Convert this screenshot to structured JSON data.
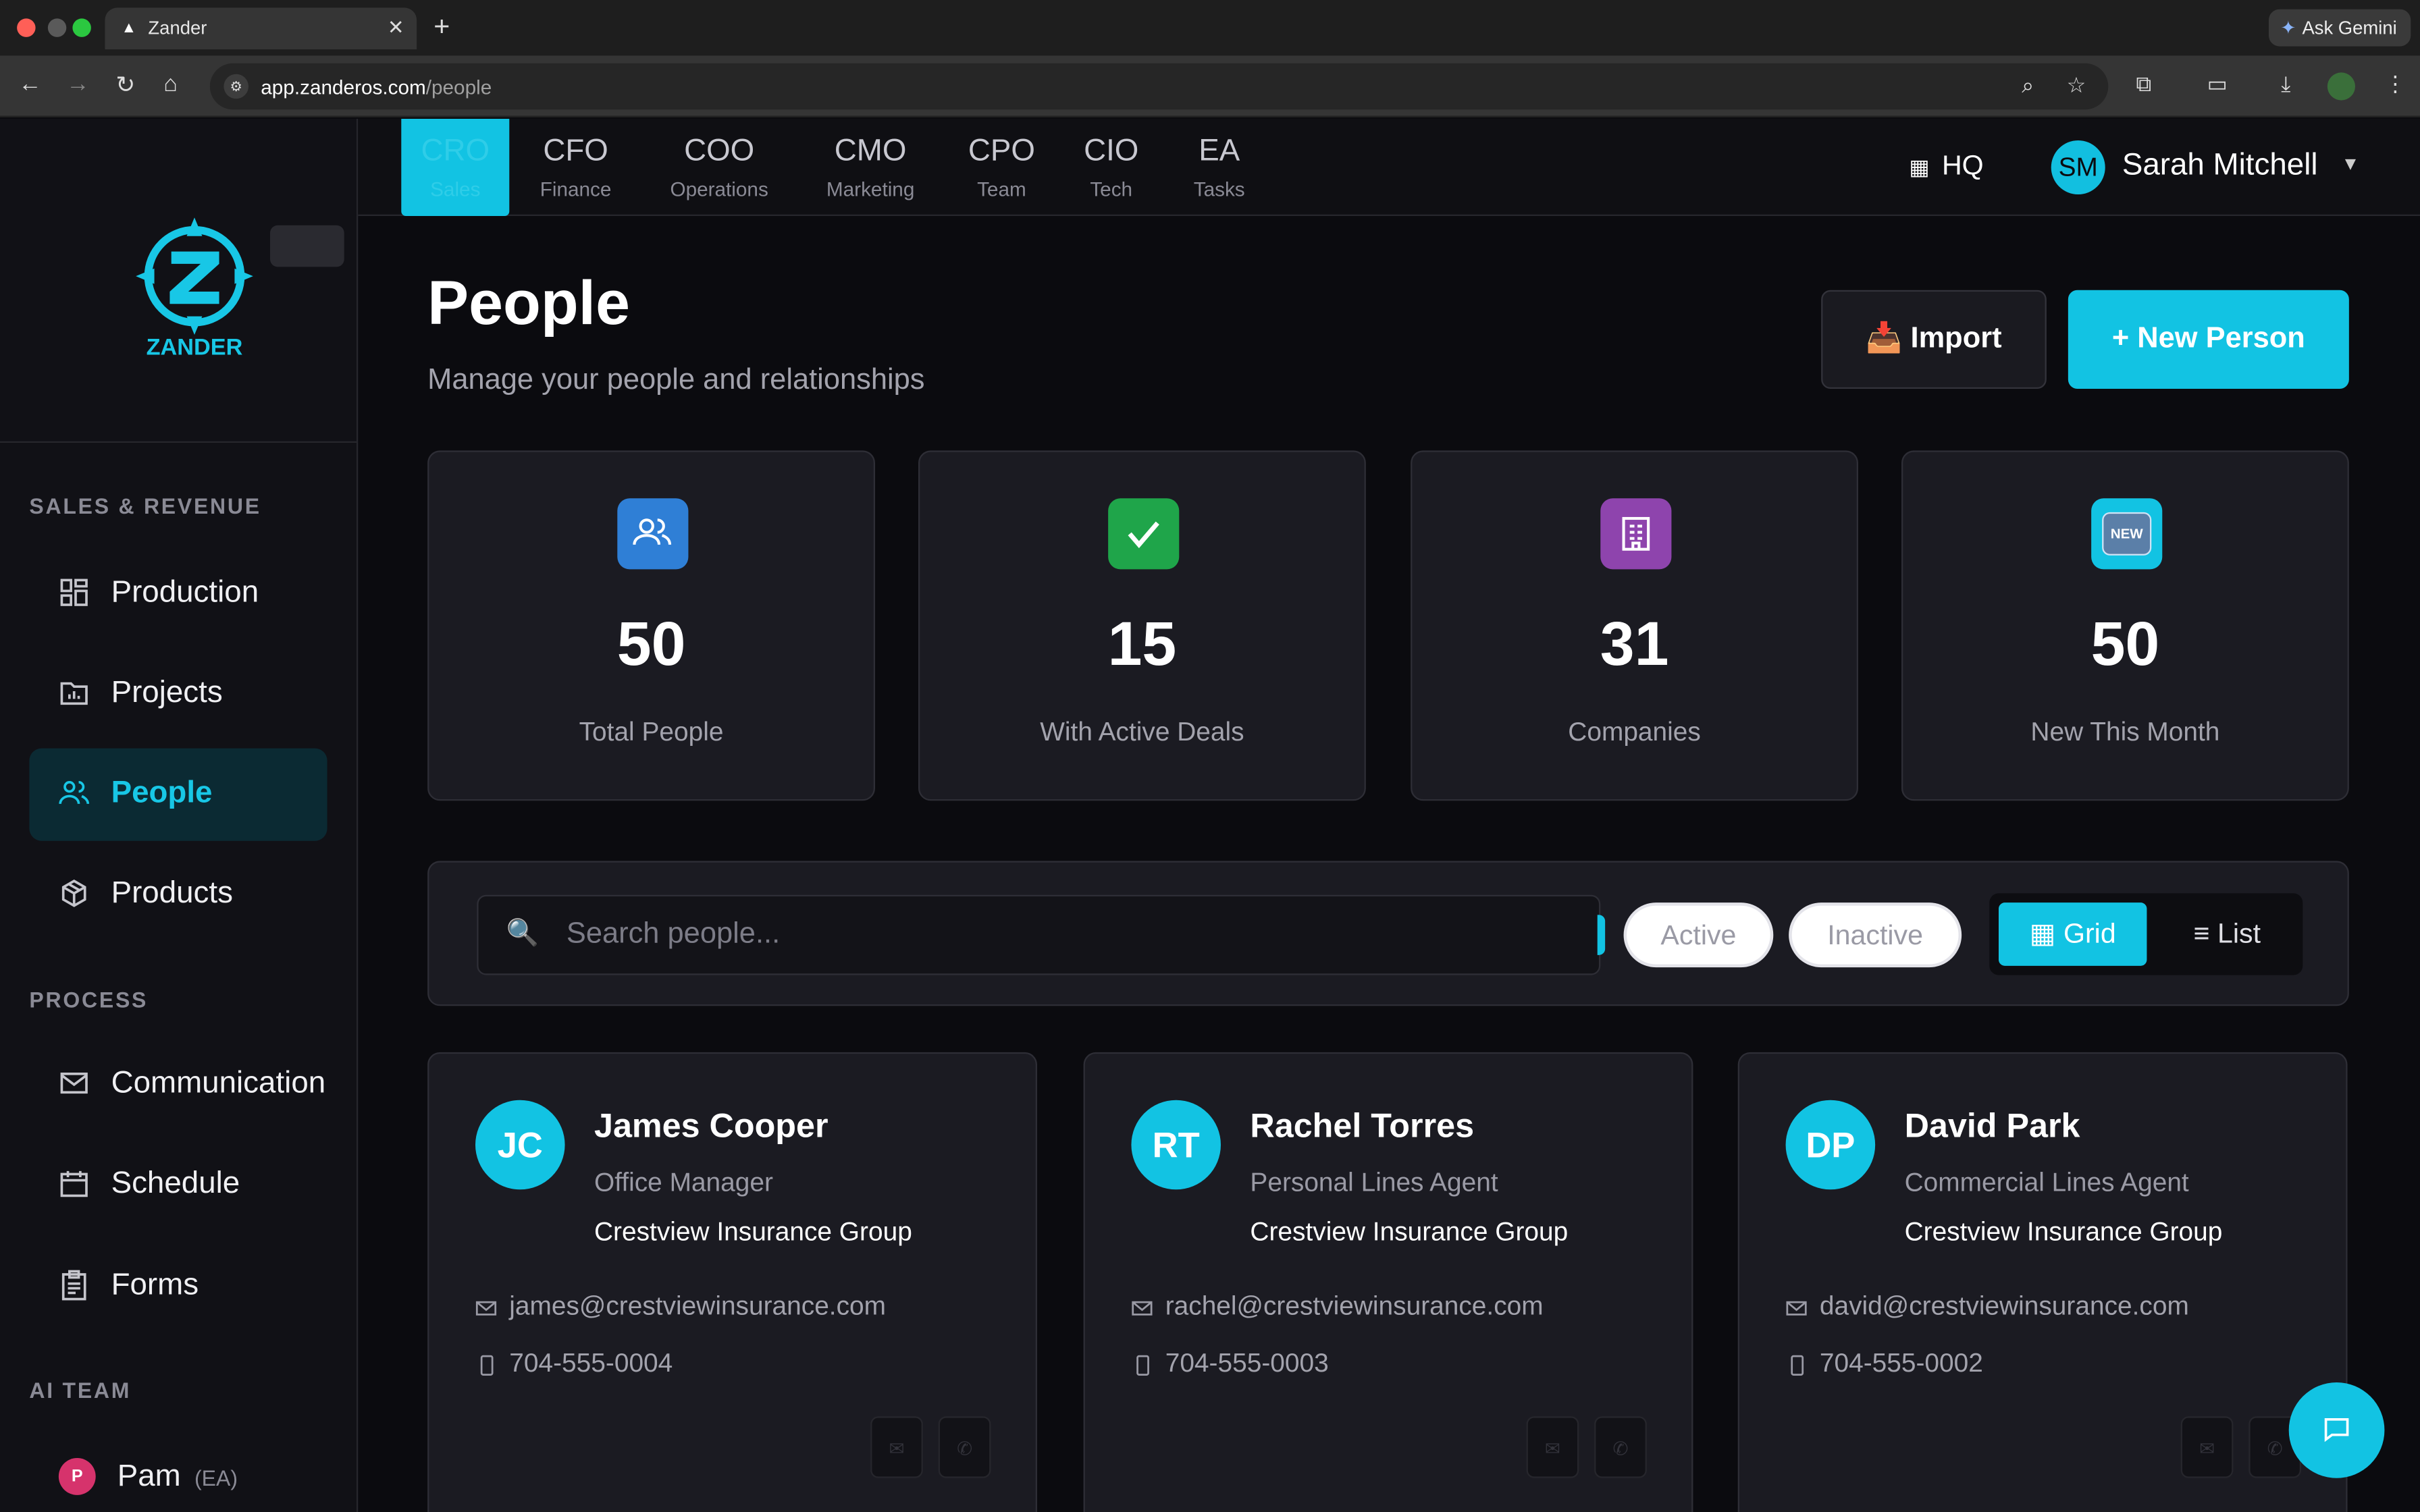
{
  "browser": {
    "tab_title": "Zander",
    "url_host": "app.zanderos.com",
    "url_path": "/people",
    "gemini_label": "Ask Gemini"
  },
  "sidebar": {
    "logo_text": "ZANDER",
    "sections": [
      {
        "label": "SALES & REVENUE"
      },
      {
        "label": "PROCESS"
      },
      {
        "label": "AI TEAM"
      }
    ],
    "items": [
      {
        "label": "Production",
        "icon": "dashboard-icon"
      },
      {
        "label": "Projects",
        "icon": "folder-chart-icon"
      },
      {
        "label": "People",
        "icon": "people-icon",
        "active": true
      },
      {
        "label": "Products",
        "icon": "box-icon"
      },
      {
        "label": "Communication",
        "icon": "mail-icon"
      },
      {
        "label": "Schedule",
        "icon": "calendar-icon"
      },
      {
        "label": "Forms",
        "icon": "clipboard-icon"
      }
    ],
    "ai_team": {
      "initial": "P",
      "name": "Pam",
      "role": "(EA)"
    }
  },
  "topnav": {
    "execs": [
      {
        "code": "CRO",
        "sub": "Sales",
        "active": true
      },
      {
        "code": "CFO",
        "sub": "Finance"
      },
      {
        "code": "COO",
        "sub": "Operations"
      },
      {
        "code": "CMO",
        "sub": "Marketing"
      },
      {
        "code": "CPO",
        "sub": "Team"
      },
      {
        "code": "CIO",
        "sub": "Tech"
      },
      {
        "code": "EA",
        "sub": "Tasks"
      }
    ],
    "hq_label": "HQ",
    "user": {
      "initials": "SM",
      "name": "Sarah Mitchell"
    }
  },
  "header": {
    "title": "People",
    "subtitle": "Manage your people and relationships",
    "import_label": "📥 Import",
    "new_label": "+ New Person"
  },
  "stats": [
    {
      "value": "50",
      "label": "Total People",
      "icon": "people-icon",
      "color": "#2f7fd6"
    },
    {
      "value": "15",
      "label": "With Active Deals",
      "icon": "check-icon",
      "color": "#1fa54a"
    },
    {
      "value": "31",
      "label": "Companies",
      "icon": "building-icon",
      "color": "#8e44ad"
    },
    {
      "value": "50",
      "label": "New This Month",
      "icon": "new-badge-icon",
      "color": "#12c3e3",
      "badge": "NEW"
    }
  ],
  "filters": {
    "search_placeholder": "Search people...",
    "active_label": "Active",
    "inactive_label": "Inactive",
    "grid_label": "▦ Grid",
    "list_label": "≡ List",
    "view": "grid"
  },
  "people": [
    {
      "initials": "JC",
      "name": "James Cooper",
      "role": "Office Manager",
      "company": "Crestview Insurance Group",
      "email": "james@crestviewinsurance.com",
      "phone": "704-555-0004"
    },
    {
      "initials": "RT",
      "name": "Rachel Torres",
      "role": "Personal Lines Agent",
      "company": "Crestview Insurance Group",
      "email": "rachel@crestviewinsurance.com",
      "phone": "704-555-0003"
    },
    {
      "initials": "DP",
      "name": "David Park",
      "role": "Commercial Lines Agent",
      "company": "Crestview Insurance Group",
      "email": "david@crestviewinsurance.com",
      "phone": "704-555-0002"
    }
  ],
  "colors": {
    "accent": "#12c3e3",
    "background": "#0b0b0f",
    "card": "#1b1b22"
  }
}
